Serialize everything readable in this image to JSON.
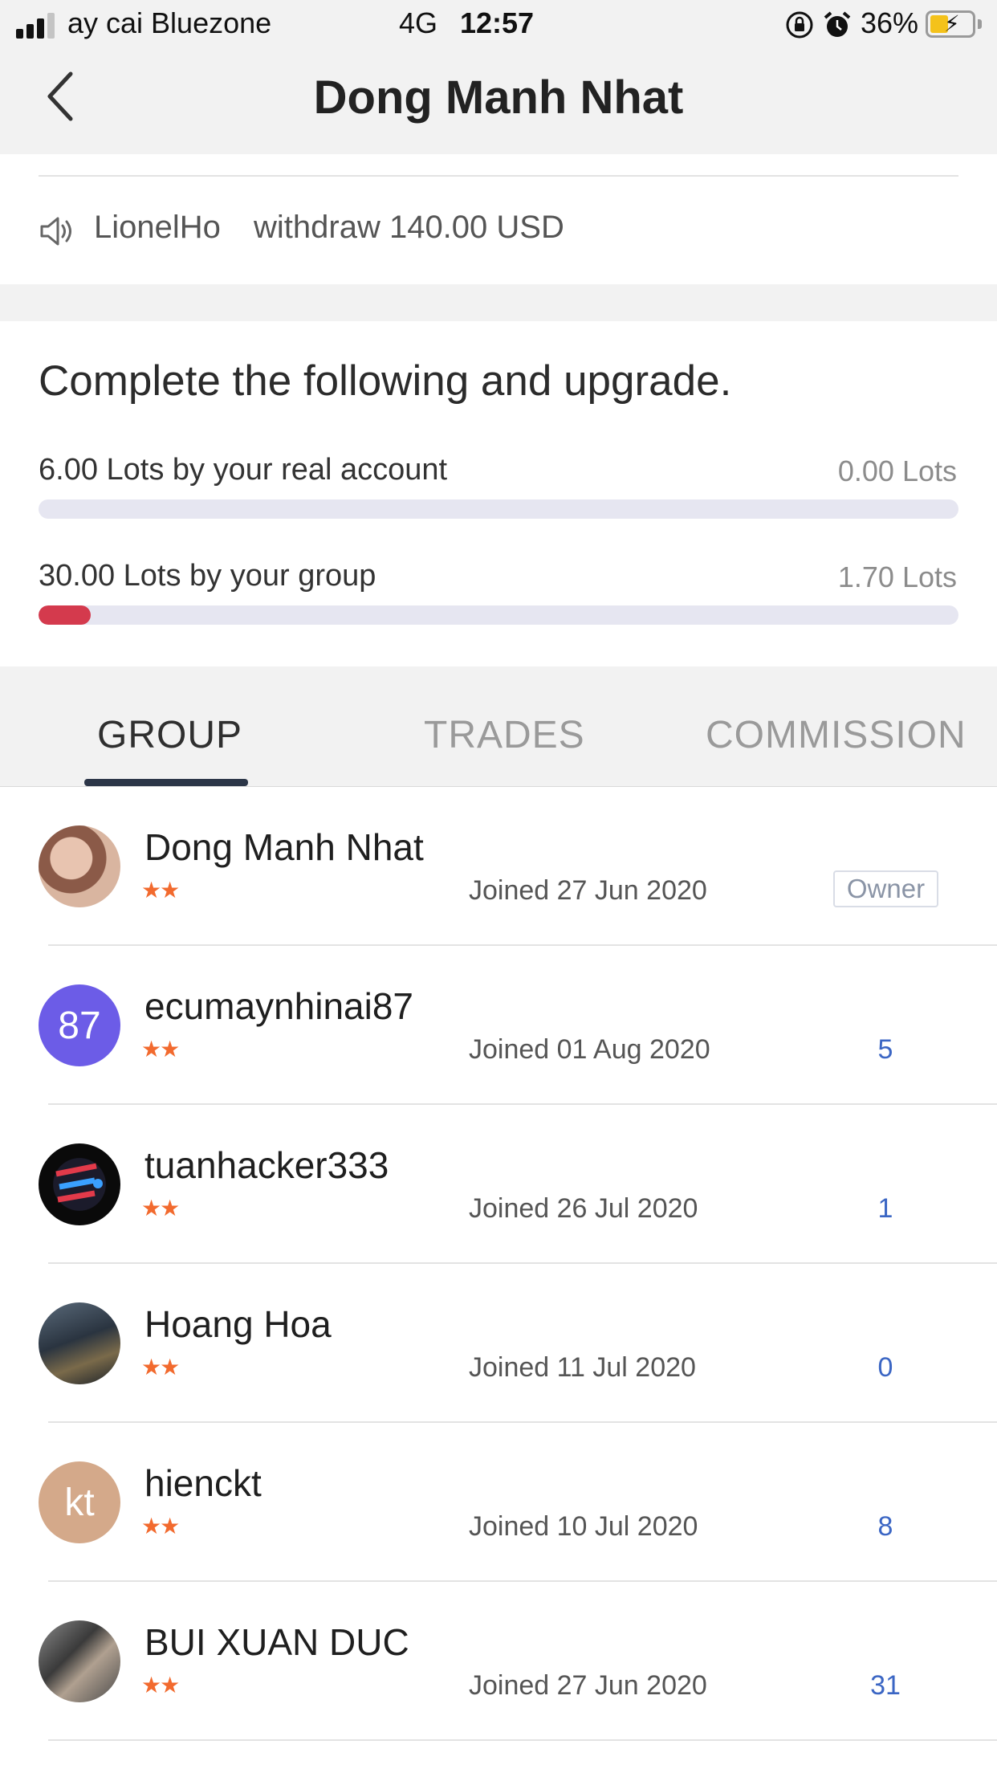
{
  "status_bar": {
    "carrier": "ay cai Bluezone",
    "network": "4G",
    "time": "12:57",
    "battery_percent": "36%",
    "icons": [
      "signal-icon",
      "rotation-lock-icon",
      "alarm-icon",
      "battery-charging-icon"
    ]
  },
  "nav": {
    "title": "Dong Manh Nhat",
    "back_icon": "chevron-left-icon"
  },
  "announcement": {
    "icon": "speaker-icon",
    "user": "LionelHo",
    "text": "withdraw 140.00 USD"
  },
  "upgrade": {
    "title": "Complete the following and upgrade.",
    "requirements": [
      {
        "label": "6.00 Lots by your real account",
        "value": "0.00 Lots",
        "progress": 0.0
      },
      {
        "label": "30.00 Lots by your group",
        "value": "1.70 Lots",
        "progress": 0.057
      }
    ],
    "progress_color": "#d43a4d"
  },
  "tabs": [
    {
      "label": "GROUP",
      "active": true
    },
    {
      "label": "TRADES",
      "active": false
    },
    {
      "label": "COMMISSION",
      "active": false
    }
  ],
  "members": [
    {
      "name": "Dong Manh Nhat",
      "stars": "★★",
      "joined": "Joined 27 Jun 2020",
      "badge": "Owner",
      "count": "",
      "avatar_initials": "",
      "avatar_color": "#c9a08a"
    },
    {
      "name": "ecumaynhinai87",
      "stars": "★★",
      "joined": "Joined 01 Aug 2020",
      "badge": "",
      "count": "5",
      "avatar_initials": "87",
      "avatar_color": "#6c5ce7"
    },
    {
      "name": "tuanhacker333",
      "stars": "★★",
      "joined": "Joined 26 Jul 2020",
      "badge": "",
      "count": "1",
      "avatar_initials": "",
      "avatar_color": "#111111"
    },
    {
      "name": "Hoang Hoa",
      "stars": "★★",
      "joined": "Joined 11 Jul 2020",
      "badge": "",
      "count": "0",
      "avatar_initials": "",
      "avatar_color": "#3a4a5a"
    },
    {
      "name": "hienckt",
      "stars": "★★",
      "joined": "Joined 10 Jul 2020",
      "badge": "",
      "count": "8",
      "avatar_initials": "kt",
      "avatar_color": "#d4a98a"
    },
    {
      "name": "BUI XUAN DUC",
      "stars": "★★",
      "joined": "Joined 27 Jun 2020",
      "badge": "",
      "count": "31",
      "avatar_initials": "",
      "avatar_color": "#6b6b6b"
    }
  ]
}
